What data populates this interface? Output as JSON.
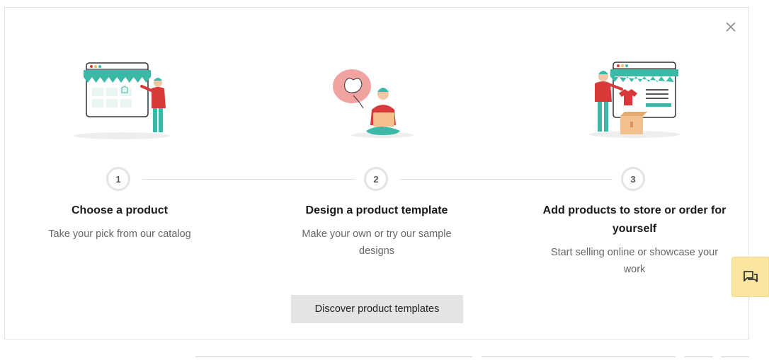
{
  "steps": [
    {
      "number": "1",
      "title": "Choose a product",
      "description": "Take your pick from our catalog"
    },
    {
      "number": "2",
      "title": "Design a product template",
      "description": "Make your own or try our sample designs"
    },
    {
      "number": "3",
      "title": "Add products to store or order for yourself",
      "description": "Start selling online or showcase your work"
    }
  ],
  "cta": {
    "label": "Discover product templates"
  },
  "icons": {
    "close": "close-icon",
    "chat": "chat-icon"
  },
  "colors": {
    "accent_teal": "#3bb9a7",
    "accent_red": "#d83a3a",
    "cta_bg": "#e4e4e4",
    "chat_bg": "#fbe6a0"
  }
}
